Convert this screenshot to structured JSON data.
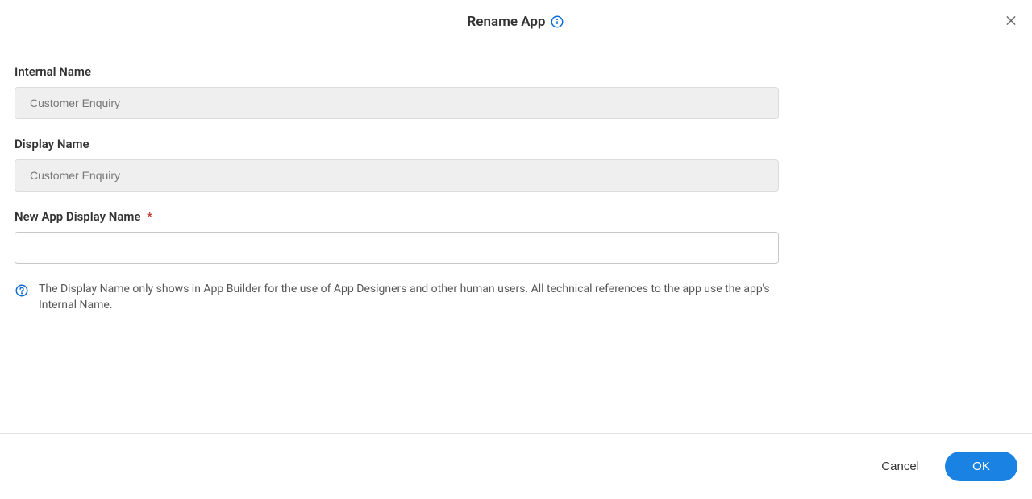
{
  "dialog": {
    "title": "Rename App",
    "close_label": "Close"
  },
  "form": {
    "internal_name": {
      "label": "Internal Name",
      "value": "Customer Enquiry"
    },
    "display_name": {
      "label": "Display Name",
      "value": "Customer Enquiry"
    },
    "new_display_name": {
      "label": "New App Display Name",
      "required_mark": "*",
      "value": ""
    },
    "help_text": "The Display Name only shows in App Builder for the use of App Designers and other human users. All technical references to the app use the app's Internal Name."
  },
  "footer": {
    "cancel_label": "Cancel",
    "ok_label": "OK"
  }
}
